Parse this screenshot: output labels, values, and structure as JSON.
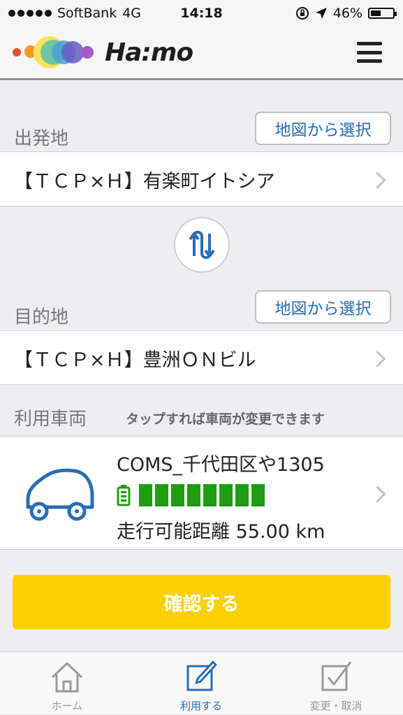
{
  "status_bar": {
    "carrier": "SoftBank",
    "network": "4G",
    "time": "14:18",
    "battery_percent": "46%",
    "battery_level": 0.46,
    "icons": [
      "signal-dots-icon",
      "rotation-lock-icon",
      "location-arrow-icon",
      "battery-icon"
    ]
  },
  "header": {
    "brand": "Ha:mo",
    "menu_icon": "hamburger-menu-icon"
  },
  "origin": {
    "label": "出発地",
    "map_button": "地図から選択",
    "value": "【ＴＣＰ×Ｈ】有楽町イトシア"
  },
  "swap_icon": "swap-arrows-icon",
  "destination": {
    "label": "目的地",
    "map_button": "地図から選択",
    "value": "【ＴＣＰ×Ｈ】豊洲ＯＮビル"
  },
  "vehicle_section": {
    "label": "利用車両",
    "hint": "タップすれば車両が変更できます",
    "vehicle_name": "COMS_千代田区や1305",
    "battery_segments_filled": 8,
    "battery_segments_total": 8,
    "range_text": "走行可能距離 55.00 km",
    "icon": "car-icon"
  },
  "confirm_button": "確認する",
  "tab_bar": {
    "tabs": [
      {
        "label": "ホーム",
        "icon": "home-icon",
        "active": false
      },
      {
        "label": "利用する",
        "icon": "edit-icon",
        "active": true
      },
      {
        "label": "変更・取消",
        "icon": "checkbox-icon",
        "active": false
      }
    ]
  },
  "colors": {
    "accent_blue": "#2a6db5",
    "confirm_yellow": "#fcd000",
    "battery_green": "#1e9c12",
    "background": "#eeeef2"
  }
}
